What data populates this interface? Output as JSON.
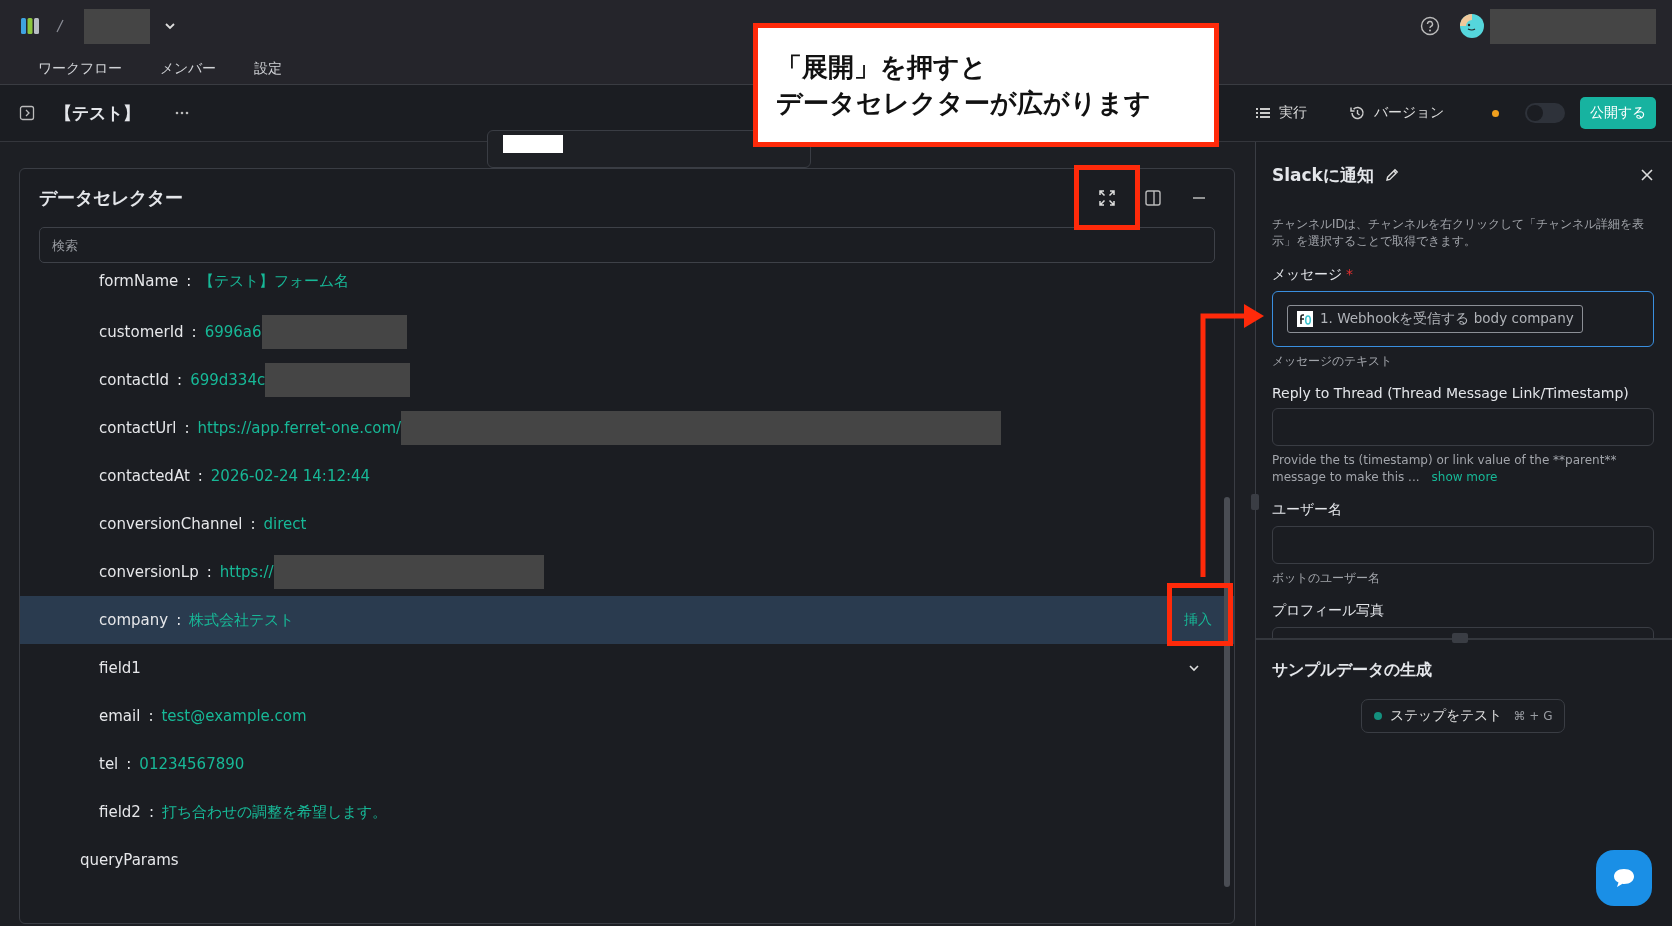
{
  "header": {
    "tabs": [
      {
        "label": "ワークフロー"
      },
      {
        "label": "メンバー"
      },
      {
        "label": "設定"
      }
    ]
  },
  "toolbar": {
    "title": "【テスト】",
    "run_label": "実行",
    "version_label": "バージョン",
    "unsaved": true,
    "toggle": {
      "on": false
    },
    "publish_label": "公開する"
  },
  "data_selector": {
    "title": "データセレクター",
    "search": {
      "placeholder": "検索"
    },
    "tree": [
      {
        "children": [
          {
            "key": "formName",
            "separator": ":",
            "value": "【テスト】フォーム名",
            "selected": false
          },
          {
            "key": "customerId",
            "separator": ":",
            "value": "6996a6",
            "redacted": true,
            "selected": false
          },
          {
            "key": "contactId",
            "separator": ":",
            "value": "699d334c",
            "redacted": true,
            "selected": false
          },
          {
            "key": "contactUrl",
            "separator": ":",
            "value": "https://app.ferret-one.com/",
            "redacted": true,
            "selected": false
          },
          {
            "key": "contactedAt",
            "separator": ":",
            "value": "2026-02-24 14:12:44",
            "selected": false
          },
          {
            "key": "conversionChannel",
            "separator": ":",
            "value": "direct",
            "selected": false
          },
          {
            "key": "conversionLp",
            "separator": ":",
            "value": "https://",
            "redacted": true,
            "selected": false
          },
          {
            "key": "company",
            "separator": ":",
            "value": "株式会社テスト",
            "selected": true,
            "action": "挿入"
          },
          {
            "key": "field1",
            "selected": false,
            "expanded": false
          },
          {
            "key": "email",
            "separator": ":",
            "value": "test@example.com",
            "selected": false
          },
          {
            "key": "tel",
            "separator": ":",
            "value": "01234567890",
            "selected": false
          },
          {
            "key": "field2",
            "separator": ":",
            "value": "打ち合わせの調整を希望します。",
            "selected": false
          }
        ]
      },
      {
        "key": "queryParams"
      }
    ]
  },
  "step_panel": {
    "title": "Slackに通知",
    "description": "チャンネルIDは、チャンネルを右クリックして「チャンネル詳細を表示」を選択することで取得できます。",
    "fields": [
      {
        "kind": "token",
        "label": "メッセージ",
        "required_mark": "*",
        "focused": true,
        "token": "1. Webhookを受信する body company",
        "helper": "メッセージのテキスト"
      },
      {
        "kind": "text",
        "label": "Reply to Thread (Thread Message Link/Timestamp)",
        "focused": false,
        "helper": "Provide the ts (timestamp) or link value of the **parent** message to make this ...",
        "link": "show more"
      },
      {
        "kind": "text",
        "label": "ユーザー名",
        "focused": false,
        "helper": "ボットのユーザー名"
      },
      {
        "kind": "text",
        "label": "プロフィール写真",
        "focused": false
      }
    ],
    "sample": {
      "title": "サンプルデータの生成",
      "button": "ステップをテスト",
      "shortcut": "⌘ + G"
    }
  },
  "annotation": {
    "callout": [
      "「展開」を押すと",
      "データセレクターが広がります"
    ]
  }
}
